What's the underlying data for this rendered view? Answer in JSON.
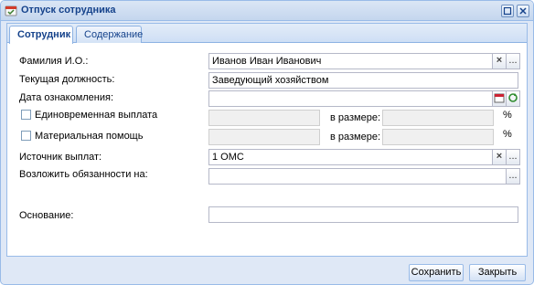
{
  "window": {
    "title": "Отпуск сотрудника"
  },
  "tabs": [
    {
      "label": "Сотрудник",
      "active": true
    },
    {
      "label": "Содержание",
      "active": false
    }
  ],
  "form": {
    "full_name": {
      "label": "Фамилия И.О.:",
      "value": "Иванов Иван Иванович"
    },
    "position": {
      "label": "Текущая должность:",
      "value": "Заведующий хозяйством"
    },
    "ack_date": {
      "label": "Дата ознакомления:",
      "value": ""
    },
    "lump_sum": {
      "label": "Единовременная выплата",
      "checked": false,
      "amount_label": "в размере:",
      "percent": "%"
    },
    "material_aid": {
      "label": "Материальная помощь",
      "checked": false,
      "amount_label": "в размере:",
      "percent": "%"
    },
    "payment_source": {
      "label": "Источник выплат:",
      "value": "1 ОМС"
    },
    "delegate": {
      "label": "Возложить обязанности на:",
      "value": ""
    },
    "basis": {
      "label": "Основание:",
      "value": ""
    }
  },
  "buttons": {
    "save": "Сохранить",
    "close": "Закрыть",
    "clear": "×",
    "select": "..."
  },
  "icons": {
    "app": "app-icon",
    "maximize": "maximize-icon",
    "close": "close-icon",
    "calendar": "calendar-icon",
    "refresh": "refresh-icon"
  },
  "colors": {
    "title_text": "#15428b",
    "border": "#99bbe8",
    "window_bg": "#dfe8f6"
  }
}
